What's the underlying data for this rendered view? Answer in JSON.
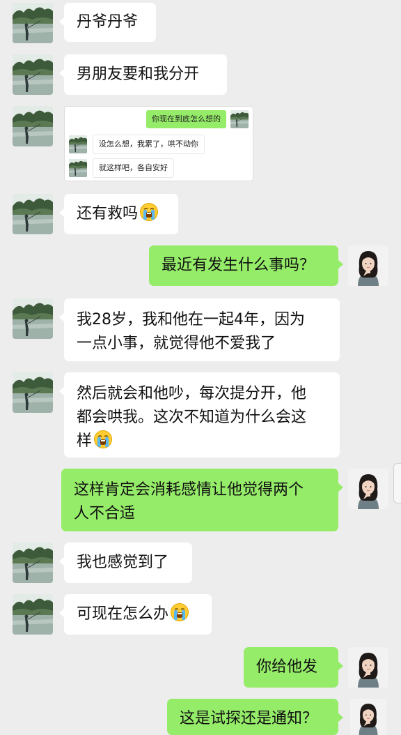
{
  "messages": [
    {
      "side": "left",
      "text": "丹爷丹爷"
    },
    {
      "side": "left",
      "text": "男朋友要和我分开"
    },
    {
      "side": "left",
      "type": "image"
    },
    {
      "side": "left",
      "text": "还有救吗",
      "emoji": "loudly-crying-face"
    },
    {
      "side": "right",
      "text": "最近有发生什么事吗？"
    },
    {
      "side": "left",
      "lines": [
        "我28岁，我和他在一起4年，因为",
        "一点小事，就觉得他不爱我了"
      ]
    },
    {
      "side": "left",
      "lines": [
        "然后就会和他吵，每次提分开，他",
        "都会哄我。这次不知道为什么会这",
        "样"
      ],
      "emoji": "loudly-crying-face"
    },
    {
      "side": "right",
      "lines": [
        "这样肯定会消耗感情让他觉得两个",
        "人不合适"
      ]
    },
    {
      "side": "left",
      "text": "我也感觉到了"
    },
    {
      "side": "left",
      "text": "可现在怎么办",
      "emoji": "loudly-crying-face"
    },
    {
      "side": "right",
      "text": "你给他发"
    },
    {
      "side": "right",
      "text": "这是试探还是通知？"
    }
  ],
  "screenshot": {
    "messages": [
      {
        "side": "right",
        "text": "你现在到底怎么想的"
      },
      {
        "side": "left",
        "text": "没怎么想，我累了，哄不动你"
      },
      {
        "side": "left",
        "text": "就这样吧，各自安好"
      }
    ]
  },
  "icons": {
    "contact_avatar": "landscape-avatar-icon",
    "self_avatar": "woman-portrait-avatar-icon",
    "emoji": "loudly-crying-face-emoji-icon"
  },
  "colors": {
    "background": "#ededed",
    "bubble_left": "#ffffff",
    "bubble_right": "#95ec69"
  }
}
